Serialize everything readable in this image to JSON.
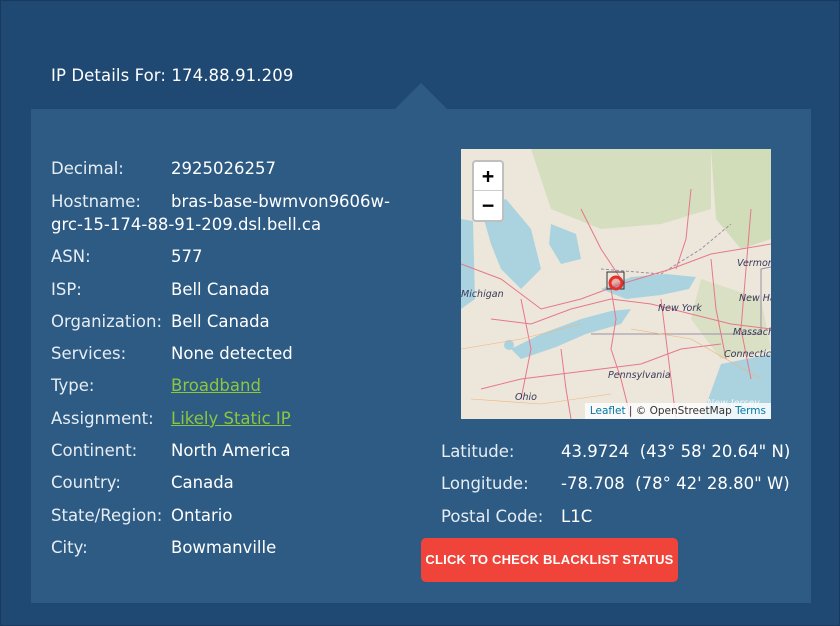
{
  "header": {
    "title": "IP Details For: 174.88.91.209"
  },
  "details": {
    "decimal": {
      "label": "Decimal:",
      "value": "2925026257"
    },
    "hostname": {
      "label": "Hostname:",
      "value_line1": "bras-base-bwmvon9606w-",
      "value_line2": "grc-15-174-88-91-209.dsl.bell.ca"
    },
    "asn": {
      "label": "ASN:",
      "value": "577"
    },
    "isp": {
      "label": "ISP:",
      "value": "Bell Canada"
    },
    "organization": {
      "label": "Organization:",
      "value": "Bell Canada"
    },
    "services": {
      "label": "Services:",
      "value": "None detected"
    },
    "type": {
      "label": "Type:",
      "value": "Broadband"
    },
    "assignment": {
      "label": "Assignment:",
      "value": "Likely Static IP"
    },
    "continent": {
      "label": "Continent:",
      "value": "North America"
    },
    "country": {
      "label": "Country:",
      "value": "Canada"
    },
    "state": {
      "label": "State/Region:",
      "value": "Ontario"
    },
    "city": {
      "label": "City:",
      "value": "Bowmanville"
    }
  },
  "geo": {
    "latitude": {
      "label": "Latitude:",
      "value": "43.9724  (43° 58' 20.64\" N)"
    },
    "longitude": {
      "label": "Longitude:",
      "value": "-78.708  (78° 42' 28.80\" W)"
    },
    "postal": {
      "label": "Postal Code:",
      "value": "L1C"
    }
  },
  "map": {
    "zoom_in": "+",
    "zoom_out": "−",
    "attribution": {
      "leaflet": "Leaflet",
      "separator": " | © OpenStreetMap ",
      "terms": "Terms"
    },
    "labels": {
      "michigan": "Michigan",
      "new_york": "New York",
      "pennsylvania": "Pennsylvania",
      "ohio": "Ohio",
      "vermont": "Vermor",
      "new_hampshire": "New Ha",
      "massachusetts": "Massach",
      "connecticut": "Connectic",
      "new_jersey": "New Jersey"
    },
    "marker_icon": "location-circle-icon"
  },
  "actions": {
    "blacklist_button": "CLICK TO CHECK BLACKLIST STATUS"
  },
  "colors": {
    "background": "#1f4973",
    "panel": "#2d5b84",
    "link": "#8cc63f",
    "button": "#f0443a"
  }
}
